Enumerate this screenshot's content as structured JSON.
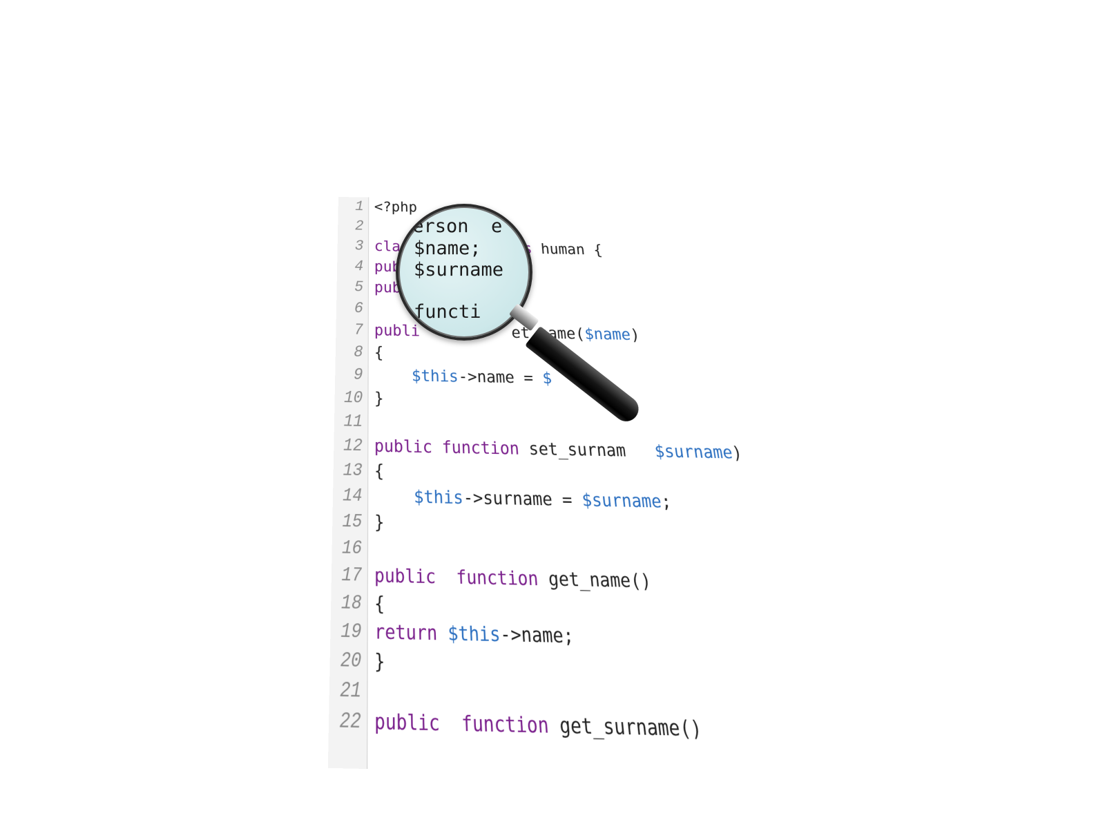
{
  "code": {
    "lines": [
      {
        "num": "1",
        "tokens": [
          {
            "t": "<?php",
            "c": "plain"
          }
        ]
      },
      {
        "num": "2",
        "tokens": []
      },
      {
        "num": "3",
        "tokens": [
          {
            "t": "clas",
            "c": "kw"
          },
          {
            "t": "          ",
            "c": "plain"
          },
          {
            "t": "ends",
            "c": "kw"
          },
          {
            "t": " human {",
            "c": "plain"
          }
        ]
      },
      {
        "num": "4",
        "tokens": [
          {
            "t": "publ",
            "c": "kw"
          }
        ]
      },
      {
        "num": "5",
        "tokens": [
          {
            "t": "publ",
            "c": "kw"
          }
        ]
      },
      {
        "num": "6",
        "tokens": []
      },
      {
        "num": "7",
        "tokens": [
          {
            "t": "publi",
            "c": "kw"
          },
          {
            "t": "          ",
            "c": "plain"
          },
          {
            "t": "et_name(",
            "c": "plain"
          },
          {
            "t": "$name",
            "c": "var"
          },
          {
            "t": ")",
            "c": "plain"
          }
        ]
      },
      {
        "num": "8",
        "tokens": [
          {
            "t": "{",
            "c": "plain"
          }
        ]
      },
      {
        "num": "9",
        "tokens": [
          {
            "t": "    ",
            "c": "plain"
          },
          {
            "t": "$this",
            "c": "var"
          },
          {
            "t": "->name = ",
            "c": "plain"
          },
          {
            "t": "$",
            "c": "var"
          },
          {
            "t": "    ",
            "c": "plain"
          },
          {
            "t": "e",
            "c": "var"
          },
          {
            "t": ";",
            "c": "plain"
          }
        ]
      },
      {
        "num": "10",
        "tokens": [
          {
            "t": "}",
            "c": "plain"
          }
        ]
      },
      {
        "num": "11",
        "tokens": []
      },
      {
        "num": "12",
        "tokens": [
          {
            "t": "public",
            "c": "kw"
          },
          {
            "t": " ",
            "c": "plain"
          },
          {
            "t": "function",
            "c": "kw"
          },
          {
            "t": " set_surnam",
            "c": "plain"
          },
          {
            "t": "   ",
            "c": "plain"
          },
          {
            "t": "$surname",
            "c": "var"
          },
          {
            "t": ")",
            "c": "plain"
          }
        ]
      },
      {
        "num": "13",
        "tokens": [
          {
            "t": "{",
            "c": "plain"
          }
        ]
      },
      {
        "num": "14",
        "tokens": [
          {
            "t": "    ",
            "c": "plain"
          },
          {
            "t": "$this",
            "c": "var"
          },
          {
            "t": "->surname = ",
            "c": "plain"
          },
          {
            "t": "$surname",
            "c": "var"
          },
          {
            "t": ";",
            "c": "plain"
          }
        ]
      },
      {
        "num": "15",
        "tokens": [
          {
            "t": "}",
            "c": "plain"
          }
        ]
      },
      {
        "num": "16",
        "tokens": []
      },
      {
        "num": "17",
        "tokens": [
          {
            "t": "public",
            "c": "kw"
          },
          {
            "t": "  ",
            "c": "plain"
          },
          {
            "t": "function",
            "c": "kw"
          },
          {
            "t": " get_name()",
            "c": "plain"
          }
        ]
      },
      {
        "num": "18",
        "tokens": [
          {
            "t": "{",
            "c": "plain"
          }
        ]
      },
      {
        "num": "19",
        "tokens": [
          {
            "t": "return",
            "c": "kw"
          },
          {
            "t": " ",
            "c": "plain"
          },
          {
            "t": "$this",
            "c": "var"
          },
          {
            "t": "->name;",
            "c": "plain"
          }
        ]
      },
      {
        "num": "20",
        "tokens": [
          {
            "t": "}",
            "c": "plain"
          }
        ]
      },
      {
        "num": "21",
        "tokens": []
      },
      {
        "num": "22",
        "tokens": [
          {
            "t": "public",
            "c": "kw"
          },
          {
            "t": "  ",
            "c": "plain"
          },
          {
            "t": "function",
            "c": "kw"
          },
          {
            "t": " get_surname()",
            "c": "plain"
          }
        ]
      }
    ]
  },
  "magnified": {
    "line1_a": "person",
    "line1_b": "e",
    "line2": "$name;",
    "line3": "$surname",
    "line4": "functi"
  },
  "colors": {
    "keyword": "#7a1f8c",
    "variable": "#2b6fc0",
    "plain": "#222222",
    "line_number": "#8a8a8a"
  }
}
